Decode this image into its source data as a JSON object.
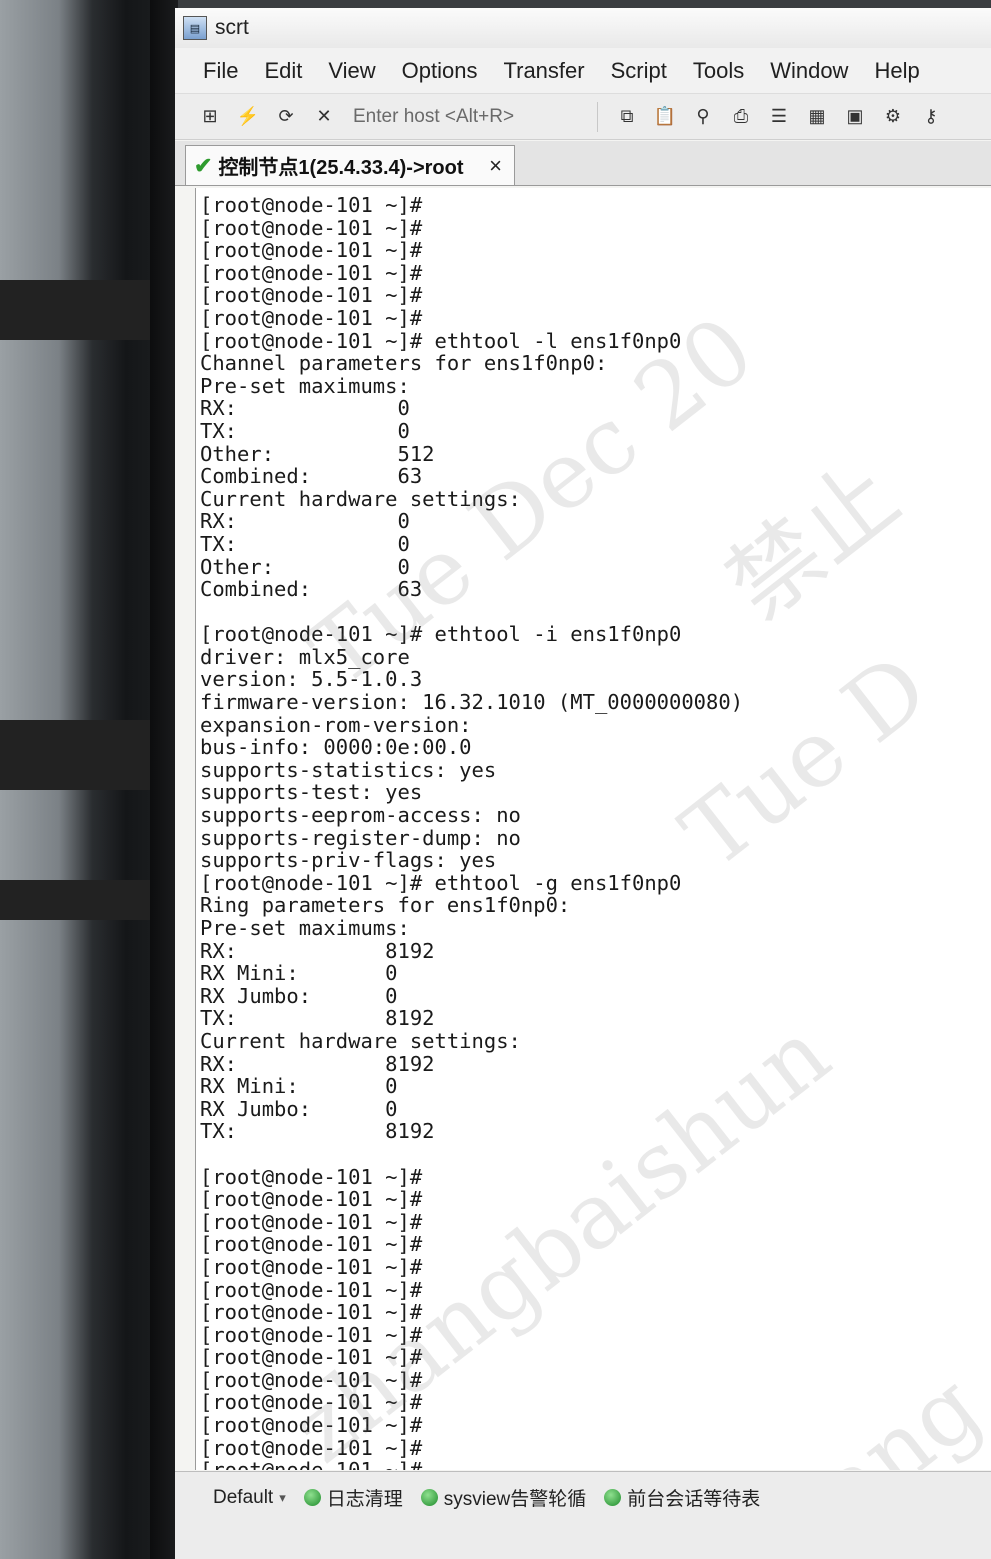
{
  "window": {
    "title": "scrt"
  },
  "menu": [
    "File",
    "Edit",
    "View",
    "Options",
    "Transfer",
    "Script",
    "Tools",
    "Window",
    "Help"
  ],
  "toolbar": {
    "host_placeholder": "Enter host <Alt+R>",
    "left_icons": [
      "connect-icon",
      "quick-connect-icon",
      "reconnect-icon",
      "disconnect-icon"
    ],
    "right_icons": [
      "copy-icon",
      "paste-icon",
      "find-icon",
      "print-icon",
      "print-setup-icon",
      "log-icon",
      "session-options-icon",
      "global-options-icon",
      "keymap-icon"
    ]
  },
  "tab": {
    "label": "控制节点1(25.4.33.4)->root",
    "close": "×"
  },
  "terminal": {
    "lines": [
      "[root@node-101 ~]#",
      "[root@node-101 ~]#",
      "[root@node-101 ~]#",
      "[root@node-101 ~]#",
      "[root@node-101 ~]#",
      "[root@node-101 ~]#",
      "[root@node-101 ~]# ethtool -l ens1f0np0",
      "Channel parameters for ens1f0np0:",
      "Pre-set maximums:",
      "RX:             0",
      "TX:             0",
      "Other:          512",
      "Combined:       63",
      "Current hardware settings:",
      "RX:             0",
      "TX:             0",
      "Other:          0",
      "Combined:       63",
      "",
      "[root@node-101 ~]# ethtool -i ens1f0np0",
      "driver: mlx5_core",
      "version: 5.5-1.0.3",
      "firmware-version: 16.32.1010 (MT_0000000080)",
      "expansion-rom-version:",
      "bus-info: 0000:0e:00.0",
      "supports-statistics: yes",
      "supports-test: yes",
      "supports-eeprom-access: no",
      "supports-register-dump: no",
      "supports-priv-flags: yes",
      "[root@node-101 ~]# ethtool -g ens1f0np0",
      "Ring parameters for ens1f0np0:",
      "Pre-set maximums:",
      "RX:            8192",
      "RX Mini:       0",
      "RX Jumbo:      0",
      "TX:            8192",
      "Current hardware settings:",
      "RX:            8192",
      "RX Mini:       0",
      "RX Jumbo:      0",
      "TX:            8192",
      "",
      "[root@node-101 ~]#",
      "[root@node-101 ~]#",
      "[root@node-101 ~]#",
      "[root@node-101 ~]#",
      "[root@node-101 ~]#",
      "[root@node-101 ~]#",
      "[root@node-101 ~]#",
      "[root@node-101 ~]#",
      "[root@node-101 ~]#",
      "[root@node-101 ~]#",
      "[root@node-101 ~]#",
      "[root@node-101 ~]#",
      "[root@node-101 ~]#",
      "[root@node-101 ~]#",
      "[root@node-101 ~]#",
      "[root@node-101 ~]#",
      "[root@node-101 ~]#",
      "[root@node-101 ~]#",
      "[root@node-101 ~]#",
      "[root@node-101 ~]#"
    ]
  },
  "watermark": [
    "Tue Dec 20",
    "禁止",
    "Tue D",
    "zhangbaishun",
    "zhang"
  ],
  "statusbar": {
    "default_label": "Default",
    "items": [
      "日志清理",
      "sysview告警轮循",
      "前台会话等待表"
    ]
  }
}
